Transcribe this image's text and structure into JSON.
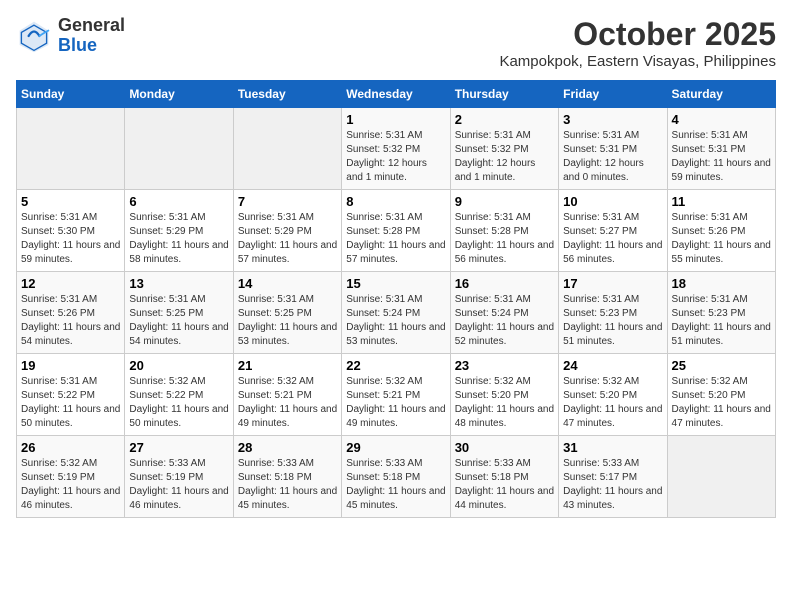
{
  "header": {
    "logo_general": "General",
    "logo_blue": "Blue",
    "month": "October 2025",
    "location": "Kampokpok, Eastern Visayas, Philippines"
  },
  "weekdays": [
    "Sunday",
    "Monday",
    "Tuesday",
    "Wednesday",
    "Thursday",
    "Friday",
    "Saturday"
  ],
  "weeks": [
    [
      {
        "day": "",
        "empty": true
      },
      {
        "day": "",
        "empty": true
      },
      {
        "day": "",
        "empty": true
      },
      {
        "day": "1",
        "sunrise": "5:31 AM",
        "sunset": "5:32 PM",
        "daylight": "12 hours and 1 minute."
      },
      {
        "day": "2",
        "sunrise": "5:31 AM",
        "sunset": "5:32 PM",
        "daylight": "12 hours and 1 minute."
      },
      {
        "day": "3",
        "sunrise": "5:31 AM",
        "sunset": "5:31 PM",
        "daylight": "12 hours and 0 minutes."
      },
      {
        "day": "4",
        "sunrise": "5:31 AM",
        "sunset": "5:31 PM",
        "daylight": "11 hours and 59 minutes."
      }
    ],
    [
      {
        "day": "5",
        "sunrise": "5:31 AM",
        "sunset": "5:30 PM",
        "daylight": "11 hours and 59 minutes."
      },
      {
        "day": "6",
        "sunrise": "5:31 AM",
        "sunset": "5:29 PM",
        "daylight": "11 hours and 58 minutes."
      },
      {
        "day": "7",
        "sunrise": "5:31 AM",
        "sunset": "5:29 PM",
        "daylight": "11 hours and 57 minutes."
      },
      {
        "day": "8",
        "sunrise": "5:31 AM",
        "sunset": "5:28 PM",
        "daylight": "11 hours and 57 minutes."
      },
      {
        "day": "9",
        "sunrise": "5:31 AM",
        "sunset": "5:28 PM",
        "daylight": "11 hours and 56 minutes."
      },
      {
        "day": "10",
        "sunrise": "5:31 AM",
        "sunset": "5:27 PM",
        "daylight": "11 hours and 56 minutes."
      },
      {
        "day": "11",
        "sunrise": "5:31 AM",
        "sunset": "5:26 PM",
        "daylight": "11 hours and 55 minutes."
      }
    ],
    [
      {
        "day": "12",
        "sunrise": "5:31 AM",
        "sunset": "5:26 PM",
        "daylight": "11 hours and 54 minutes."
      },
      {
        "day": "13",
        "sunrise": "5:31 AM",
        "sunset": "5:25 PM",
        "daylight": "11 hours and 54 minutes."
      },
      {
        "day": "14",
        "sunrise": "5:31 AM",
        "sunset": "5:25 PM",
        "daylight": "11 hours and 53 minutes."
      },
      {
        "day": "15",
        "sunrise": "5:31 AM",
        "sunset": "5:24 PM",
        "daylight": "11 hours and 53 minutes."
      },
      {
        "day": "16",
        "sunrise": "5:31 AM",
        "sunset": "5:24 PM",
        "daylight": "11 hours and 52 minutes."
      },
      {
        "day": "17",
        "sunrise": "5:31 AM",
        "sunset": "5:23 PM",
        "daylight": "11 hours and 51 minutes."
      },
      {
        "day": "18",
        "sunrise": "5:31 AM",
        "sunset": "5:23 PM",
        "daylight": "11 hours and 51 minutes."
      }
    ],
    [
      {
        "day": "19",
        "sunrise": "5:31 AM",
        "sunset": "5:22 PM",
        "daylight": "11 hours and 50 minutes."
      },
      {
        "day": "20",
        "sunrise": "5:32 AM",
        "sunset": "5:22 PM",
        "daylight": "11 hours and 50 minutes."
      },
      {
        "day": "21",
        "sunrise": "5:32 AM",
        "sunset": "5:21 PM",
        "daylight": "11 hours and 49 minutes."
      },
      {
        "day": "22",
        "sunrise": "5:32 AM",
        "sunset": "5:21 PM",
        "daylight": "11 hours and 49 minutes."
      },
      {
        "day": "23",
        "sunrise": "5:32 AM",
        "sunset": "5:20 PM",
        "daylight": "11 hours and 48 minutes."
      },
      {
        "day": "24",
        "sunrise": "5:32 AM",
        "sunset": "5:20 PM",
        "daylight": "11 hours and 47 minutes."
      },
      {
        "day": "25",
        "sunrise": "5:32 AM",
        "sunset": "5:20 PM",
        "daylight": "11 hours and 47 minutes."
      }
    ],
    [
      {
        "day": "26",
        "sunrise": "5:32 AM",
        "sunset": "5:19 PM",
        "daylight": "11 hours and 46 minutes."
      },
      {
        "day": "27",
        "sunrise": "5:33 AM",
        "sunset": "5:19 PM",
        "daylight": "11 hours and 46 minutes."
      },
      {
        "day": "28",
        "sunrise": "5:33 AM",
        "sunset": "5:18 PM",
        "daylight": "11 hours and 45 minutes."
      },
      {
        "day": "29",
        "sunrise": "5:33 AM",
        "sunset": "5:18 PM",
        "daylight": "11 hours and 45 minutes."
      },
      {
        "day": "30",
        "sunrise": "5:33 AM",
        "sunset": "5:18 PM",
        "daylight": "11 hours and 44 minutes."
      },
      {
        "day": "31",
        "sunrise": "5:33 AM",
        "sunset": "5:17 PM",
        "daylight": "11 hours and 43 minutes."
      },
      {
        "day": "",
        "empty": true
      }
    ]
  ]
}
